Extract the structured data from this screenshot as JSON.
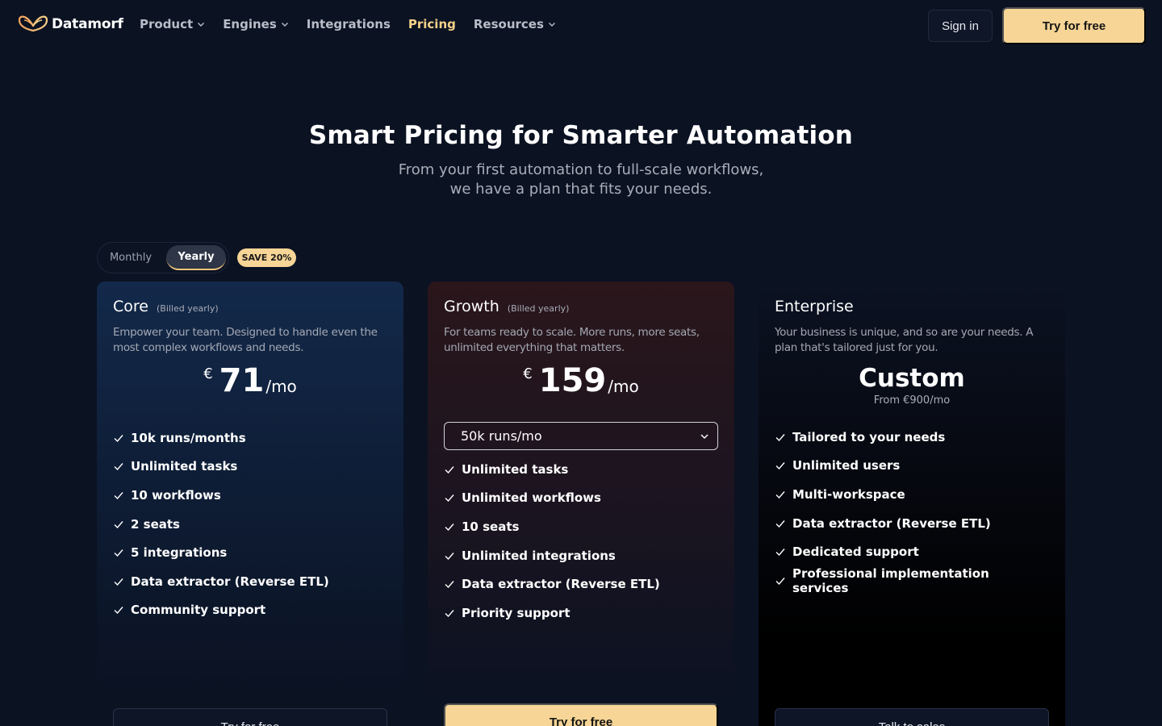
{
  "nav": {
    "brand": "Datamorf",
    "items": [
      {
        "label": "Product",
        "has_dropdown": true
      },
      {
        "label": "Engines",
        "has_dropdown": true
      },
      {
        "label": "Integrations",
        "has_dropdown": false
      },
      {
        "label": "Pricing",
        "has_dropdown": false,
        "active": true
      },
      {
        "label": "Resources",
        "has_dropdown": true
      }
    ],
    "sign_in": "Sign in",
    "try_free": "Try for free"
  },
  "hero": {
    "title": "Smart Pricing for Smarter Automation",
    "subtitle_line1": "From your first automation to full-scale workflows,",
    "subtitle_line2": "we have a plan that fits your needs."
  },
  "billing_toggle": {
    "monthly": "Monthly",
    "yearly": "Yearly",
    "selected": "Yearly",
    "save_badge": "SAVE 20%"
  },
  "plans": {
    "core": {
      "name": "Core",
      "billed": "(Billed yearly)",
      "description": "Empower your team. Designed to handle even the most complex workflows and needs.",
      "currency": "€",
      "price": "71",
      "period": "/mo",
      "features": [
        "10k runs/months",
        "Unlimited tasks",
        "10 workflows",
        "2 seats",
        "5 integrations",
        "Data extractor (Reverse ETL)",
        "Community support"
      ],
      "cta": "Try for free"
    },
    "growth": {
      "name": "Growth",
      "billed": "(Billed yearly)",
      "description": "For teams ready to scale. More runs, more seats, unlimited everything that matters.",
      "currency": "€",
      "price": "159",
      "period": "/mo",
      "runs_select": "50k runs/mo",
      "features": [
        "Unlimited tasks",
        "Unlimited workflows",
        "10 seats",
        "Unlimited integrations",
        "Data extractor (Reverse ETL)",
        "Priority support"
      ],
      "cta": "Try for free"
    },
    "enterprise": {
      "name": "Enterprise",
      "description": "Your business is unique, and so are your needs. A plan that's tailored just for you.",
      "price_label": "Custom",
      "from": "From €900/mo",
      "features": [
        "Tailored to your needs",
        "Unlimited users",
        "Multi-workspace",
        "Data extractor (Reverse ETL)",
        "Dedicated support",
        "Professional implementation services"
      ],
      "cta": "Talk to sales"
    }
  },
  "colors": {
    "background": "#0b1222",
    "accent": "#f6d596",
    "active_nav": "#f5d08a"
  }
}
